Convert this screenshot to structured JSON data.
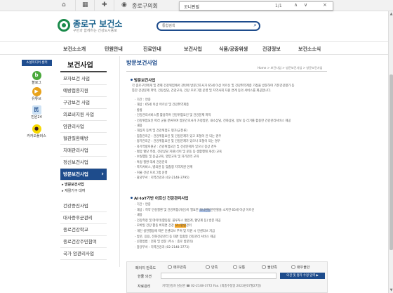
{
  "topbar": {
    "council": "종로구의회"
  },
  "find": {
    "query": "꼬니핀릴",
    "count": "1/1",
    "prev": "∧",
    "next": "∨",
    "close": "×"
  },
  "logo": {
    "name": "종로구 보건소",
    "tagline": "구민과 함께하는 건강도시종로"
  },
  "search": {
    "placeholder": "통합검색"
  },
  "nav": [
    "보건소소개",
    "민원안내",
    "진료안내",
    "보건사업",
    "식품/공중위생",
    "건강정보",
    "보건소소식"
  ],
  "left_links": {
    "banner": "소셜미디어 센터",
    "items": [
      {
        "label": "블로그",
        "color": "#4aa83c",
        "glyph": "b"
      },
      {
        "label": "유튜브",
        "color": "#e8a21a",
        "glyph": "▶"
      },
      {
        "label": "민원24",
        "color": "#cfe3f5",
        "glyph": "民"
      },
      {
        "label": "카카오플러스",
        "color": "#f7d900",
        "glyph": "●"
      }
    ]
  },
  "sidebar": {
    "title": "보건사업",
    "items": [
      "모자보건 사업",
      "예방접종지원",
      "구강보건 사업",
      "의료비지원 사업",
      "암관리사업",
      "혈관질환예방",
      "치매관리사업",
      "정신보건사업",
      "방문보건사업",
      "건강증진사업",
      "대사증후군관리",
      "종로건강학교",
      "종로건강주민참여",
      "국가 암관리사업"
    ],
    "active_index": 8,
    "subitems": [
      "방문보건사업",
      "재활기구 대여"
    ]
  },
  "page": {
    "title": "방문보건사업",
    "breadcrumb": "Home > 보건사업 > 방문보건사업 > 방문보건사업",
    "section1": "방문보건사업",
    "intro1": "각 종로구민에게 및 경제 건강위험에서 관련에 방문간호사가 65세 이상 어르신 및 건강취약계층 가정을 방문하여 기본건강평가 등",
    "intro2": "통한 건강문제 파악, 건강상담, 건강교육, 건강 프로그램 운영 및 지역사회 자원 연계 등의 서비스를 제공합니다.",
    "lines1": [
      "· 기간 : 연중",
      "· 대상 : 65세 이상 어르신 및 건강취약계층",
      "· 방법",
      "  - 건강관리서비스를 활용하여 건강위험요인 및 건강문제 파악",
      "  - 건강위험요인 따라 군을 분류하여 방문간호사가 가정방문, 내소상담, 전화상담, 정보 등 리기를 활용한 건강관리서비스 제공",
      "· 내용",
      "  - 대상자 등록 및 건강위험도 평가(군분류)",
      "    · 집중관리군 : 건강위험요인 및 건강문제가 있고 조절이 안 되는 경우",
      "    · 정기관리군 : 건강위험요인 및 건강문제가 있으나 조절이 되는 경우",
      "    · 자기역량지원군 : 건강위험요인 및 건강문제가 있으나 증상 경우",
      "  - 혈압 혈당 측정, 건강상담 지원(식이 및 운동 등 생활행태 개선) 교육",
      "  - 보실행동 및 응급교육, 영양교육 및 자기관리 교육",
      "  - 특정 질환 대세 건강관리",
      "  - 복지서비스, 병의원 등 맞춤형 지역자원 연계",
      "  - 허물 건강 프로그램 운영",
      "· 담당부서 : 지역건강과 (02-2148-3795)"
    ],
    "section2": "AI·IoT기반 어르신 건강관리사업",
    "lines2": [
      [
        "· 기간 : 연중"
      ],
      [
        "· 대상 : 허약 만성질환 및 건강위험(개선)이 필요한 ",
        "꼬니핀릴",
        "관련",
        "혈을 소지한 65세 이상 어르신"
      ],
      [
        "· 내용"
      ],
      [
        "  - 건강측정 및 데이터(활동량, 블루투스 혈압계, 혈당계 등) 방문 제공"
      ],
      [
        "  - 모바일 건강 활동 비대면 건강 ",
        "꼬니핀릴",
        "관리"
      ],
      [
        "  - 개인 실천행동에 따른 인센티브 부여 및 지원 시 인센티브 지급"
      ],
      [
        "  - 방문, 응용, 전화건강관리 등 대면 맞춤형 건강관리 서비스 제공"
      ],
      [
        "· 신청방법 : 전화 및 방문 (주소 : 종로 방문의)"
      ],
      [
        "· 담당부서 : 지역건강과 (02-2148-3773)"
      ]
    ]
  },
  "feedback": {
    "question": "페이지 만족도",
    "options": [
      "매우만족",
      "만족",
      "보통",
      "불만족",
      "매우불만"
    ],
    "opinion_label": "한줄 의견",
    "submit": "의견 및 평가 수정 입력 ▶",
    "manager_label": "자료관리",
    "manager_value": "지역건강과 담당관 ☎ 02-2148-3772  Fax. (최종수정일 2023년07월27일)"
  }
}
